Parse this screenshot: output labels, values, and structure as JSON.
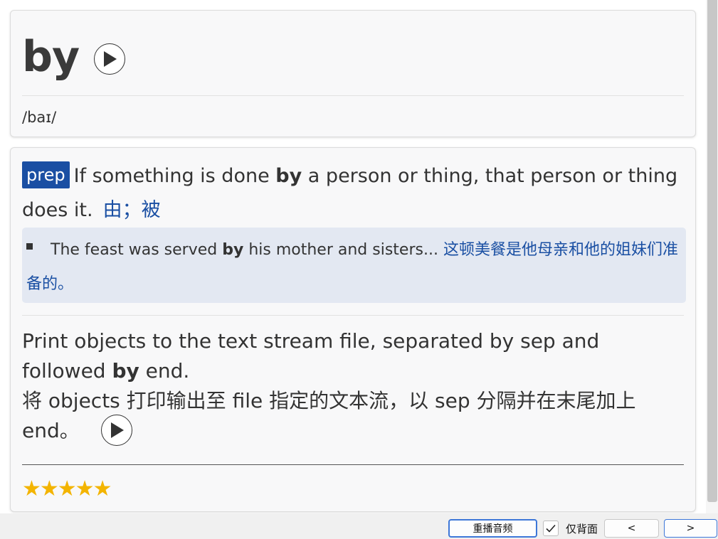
{
  "word_card": {
    "word": "by",
    "phonetic": "/baɪ/"
  },
  "definition_1": {
    "pos": "prep",
    "text_before": "If something is done ",
    "text_bold": "by",
    "text_after": " a person or thing, that person or thing does it.",
    "zh": "由；被",
    "example": {
      "before": "The feast was served ",
      "bold": "by",
      "after": " his mother and sisters...",
      "zh": "这顿美餐是他母亲和他的姐妹们准备的。"
    }
  },
  "definition_2": {
    "text_before": "Print objects to the text stream file, separated by sep and followed ",
    "text_bold": "by",
    "text_after": " end.",
    "zh": "将 objects 打印输出至 file 指定的文本流，以 sep 分隔并在末尾加上 end。"
  },
  "rating": {
    "stars": "★★★★★",
    "value": 5,
    "max": 5
  },
  "bottom_bar": {
    "replay_label": "重播音频",
    "back_only_label": "仅背面",
    "back_only_checked": true,
    "prev_label": "<",
    "next_label": ">"
  },
  "colors": {
    "accent": "#1a4fa3",
    "star": "#f3b400",
    "example_bg": "#e3e8f2"
  },
  "icons": [
    "play-icon",
    "check-icon"
  ]
}
